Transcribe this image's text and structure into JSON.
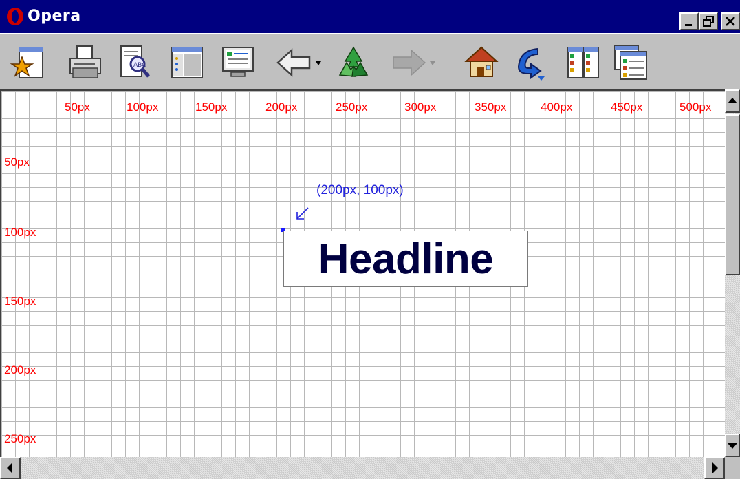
{
  "window": {
    "title": "Opera",
    "buttons": [
      "minimize",
      "restore",
      "close"
    ]
  },
  "toolbar": {
    "items": [
      {
        "name": "hotlist-icon"
      },
      {
        "name": "print-icon"
      },
      {
        "name": "find-icon"
      },
      {
        "name": "panel-icon"
      },
      {
        "name": "source-icon"
      },
      {
        "name": "back-icon"
      },
      {
        "name": "reload-icon"
      },
      {
        "name": "forward-icon"
      },
      {
        "name": "home-icon"
      },
      {
        "name": "go-icon"
      },
      {
        "name": "tile-icon"
      },
      {
        "name": "cascade-icon"
      }
    ]
  },
  "ruler": {
    "x_labels": [
      "50px",
      "100px",
      "150px",
      "200px",
      "250px",
      "300px",
      "350px",
      "400px",
      "450px",
      "500px"
    ],
    "y_labels": [
      "50px",
      "100px",
      "150px",
      "200px",
      "250px"
    ]
  },
  "annotation": {
    "coordinate": "(200px, 100px)"
  },
  "content": {
    "headline": "Headline"
  },
  "colors": {
    "ruler_text": "#ff0000",
    "annotation": "#2222dd",
    "headline_text": "#000040",
    "titlebar": "#000080"
  }
}
